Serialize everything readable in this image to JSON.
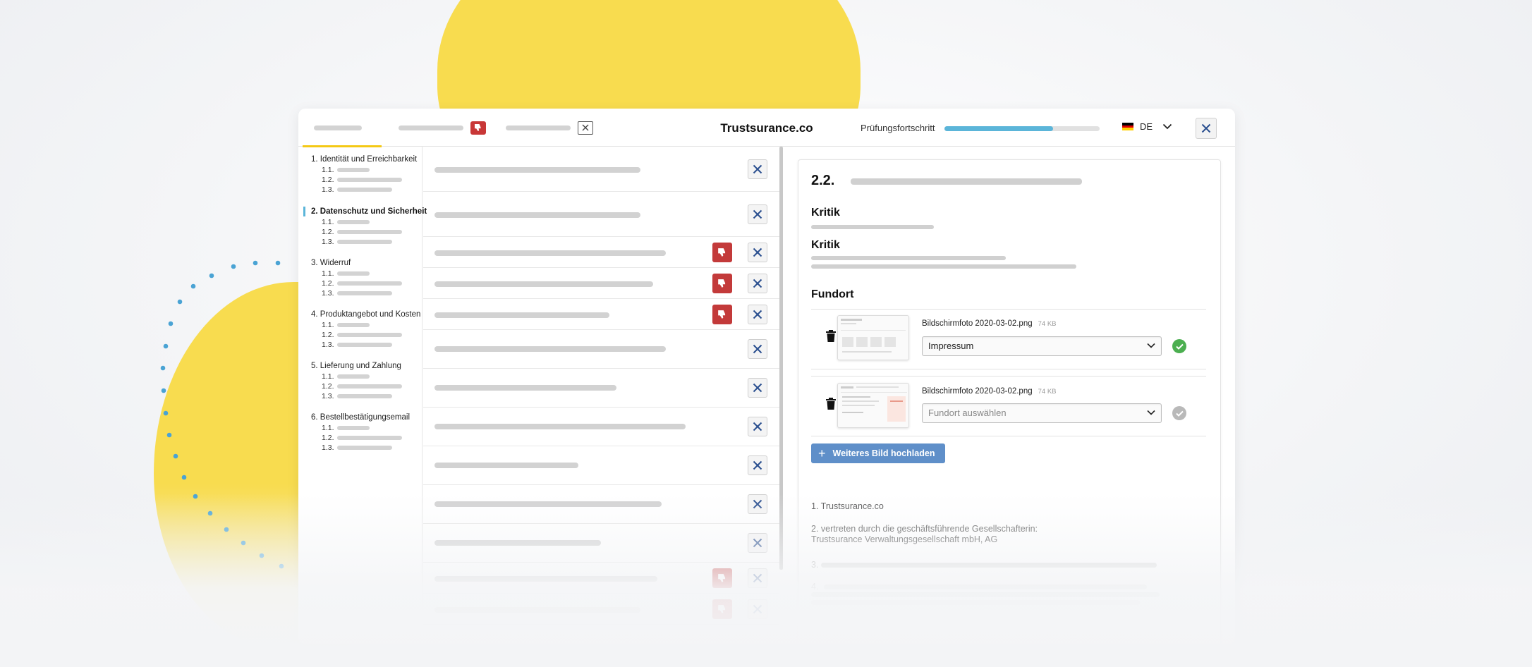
{
  "window": {
    "brand": "Trustsurance.co",
    "progress": {
      "label": "Prüfungsfortschritt",
      "value": 0.7
    },
    "language": {
      "code": "DE"
    }
  },
  "sidebar": {
    "sections": [
      {
        "title": "1. Identität und Erreichbarkeit",
        "active": false,
        "subs": [
          "1.1.",
          "1.2.",
          "1.3."
        ]
      },
      {
        "title": "2. Datenschutz und Sicherheit",
        "active": true,
        "subs": [
          "1.1.",
          "1.2.",
          "1.3."
        ]
      },
      {
        "title": "3. Widerruf",
        "active": false,
        "subs": [
          "1.1.",
          "1.2.",
          "1.3."
        ]
      },
      {
        "title": "4. Produktangebot und Kosten",
        "active": false,
        "subs": [
          "1.1.",
          "1.2.",
          "1.3."
        ]
      },
      {
        "title": "5. Lieferung und Zahlung",
        "active": false,
        "subs": [
          "1.1.",
          "1.2.",
          "1.3."
        ]
      },
      {
        "title": "6. Bestellbestätigungsemail",
        "active": false,
        "subs": [
          "1.1.",
          "1.2.",
          "1.3."
        ]
      }
    ]
  },
  "detail": {
    "number": "2.2.",
    "kritik_heading_1": "Kritik",
    "kritik_heading_2": "Kritik",
    "fundort_heading": "Fundort",
    "attachments": [
      {
        "filename": "Bildschirmfoto 2020-03-02.png",
        "size": "74 KB",
        "location": "Impressum",
        "confirmed": true
      },
      {
        "filename": "Bildschirmfoto 2020-03-02.png",
        "size": "74 KB",
        "location_placeholder": "Fundort auswählen",
        "confirmed": false
      }
    ],
    "upload_label": "Weiteres Bild hochladen",
    "imprint": {
      "line1": "1. Trustsurance.co",
      "line2a": "2. vertreten durch die geschäftsführende Gesellschafterin:",
      "line2b": "Trustsurance Verwaltungsgesellschaft mbH, AG",
      "n3": "3.",
      "n4": "4."
    }
  },
  "colors": {
    "accent_yellow": "#f8dc4f",
    "progress_blue": "#5bb5d9",
    "reject_red": "#c33a3a",
    "confirm_green": "#4caf50",
    "button_blue": "#5f8fc9"
  }
}
